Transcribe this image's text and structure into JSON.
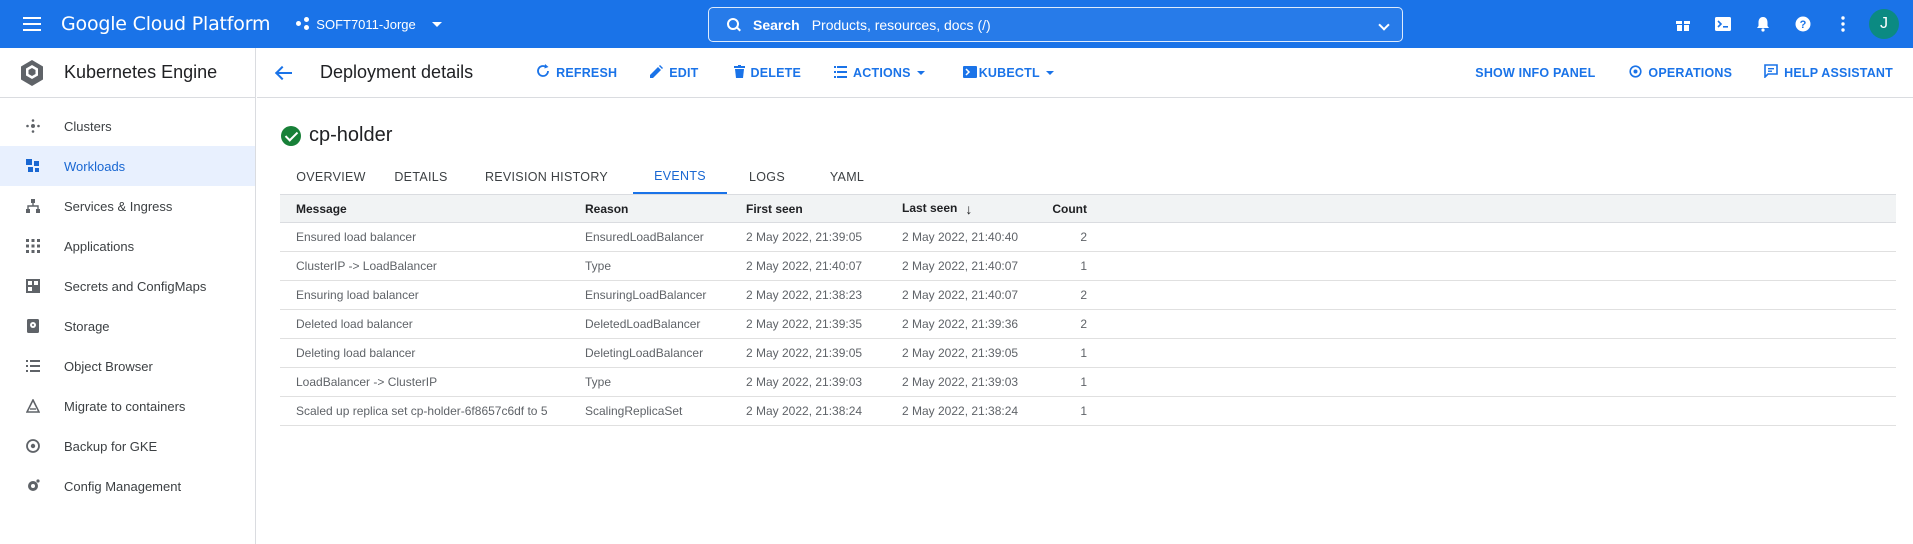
{
  "topbar": {
    "brand": "Google Cloud Platform",
    "project": "SOFT7011-Jorge",
    "search_label": "Search",
    "search_placeholder": "Products, resources, docs (/)",
    "icons": [
      "gift-icon",
      "cloud-shell-icon",
      "notifications-icon",
      "help-icon",
      "more-vert-icon"
    ],
    "avatar_initial": "J",
    "color": "#1a73e8"
  },
  "sidebar": {
    "title": "Kubernetes Engine",
    "items": [
      {
        "label": "Clusters",
        "icon": "clusters-icon"
      },
      {
        "label": "Workloads",
        "icon": "workloads-icon",
        "active": true
      },
      {
        "label": "Services & Ingress",
        "icon": "services-icon"
      },
      {
        "label": "Applications",
        "icon": "applications-icon"
      },
      {
        "label": "Secrets and ConfigMaps",
        "icon": "secrets-icon"
      },
      {
        "label": "Storage",
        "icon": "storage-icon"
      },
      {
        "label": "Object Browser",
        "icon": "object-browser-icon"
      },
      {
        "label": "Migrate to containers",
        "icon": "migrate-icon"
      },
      {
        "label": "Backup for GKE",
        "icon": "backup-icon"
      },
      {
        "label": "Config Management",
        "icon": "config-management-icon"
      }
    ]
  },
  "actionbar": {
    "title": "Deployment details",
    "refresh": "REFRESH",
    "edit": "EDIT",
    "delete": "DELETE",
    "actions": "ACTIONS",
    "kubectl": "KUBECTL",
    "show_info_panel": "SHOW INFO PANEL",
    "operations": "OPERATIONS",
    "help_assistant": "HELP ASSISTANT"
  },
  "resource": {
    "name": "cp-holder",
    "status": "ok"
  },
  "tabs": [
    {
      "label": "OVERVIEW"
    },
    {
      "label": "DETAILS"
    },
    {
      "label": "REVISION HISTORY"
    },
    {
      "label": "EVENTS",
      "active": true
    },
    {
      "label": "LOGS"
    },
    {
      "label": "YAML"
    }
  ],
  "events": {
    "headers": {
      "message": "Message",
      "reason": "Reason",
      "first_seen": "First seen",
      "last_seen": "Last seen",
      "count": "Count"
    },
    "sort_column": "last_seen",
    "rows": [
      {
        "message": "Ensured load balancer",
        "reason": "EnsuredLoadBalancer",
        "first_seen": "2 May 2022, 21:39:05",
        "last_seen": "2 May 2022, 21:40:40",
        "count": "2"
      },
      {
        "message": "ClusterIP -> LoadBalancer",
        "reason": "Type",
        "first_seen": "2 May 2022, 21:40:07",
        "last_seen": "2 May 2022, 21:40:07",
        "count": "1"
      },
      {
        "message": "Ensuring load balancer",
        "reason": "EnsuringLoadBalancer",
        "first_seen": "2 May 2022, 21:38:23",
        "last_seen": "2 May 2022, 21:40:07",
        "count": "2"
      },
      {
        "message": "Deleted load balancer",
        "reason": "DeletedLoadBalancer",
        "first_seen": "2 May 2022, 21:39:35",
        "last_seen": "2 May 2022, 21:39:36",
        "count": "2"
      },
      {
        "message": "Deleting load balancer",
        "reason": "DeletingLoadBalancer",
        "first_seen": "2 May 2022, 21:39:05",
        "last_seen": "2 May 2022, 21:39:05",
        "count": "1"
      },
      {
        "message": "LoadBalancer -> ClusterIP",
        "reason": "Type",
        "first_seen": "2 May 2022, 21:39:03",
        "last_seen": "2 May 2022, 21:39:03",
        "count": "1"
      },
      {
        "message": "Scaled up replica set cp-holder-6f8657c6df to 5",
        "reason": "ScalingReplicaSet",
        "first_seen": "2 May 2022, 21:38:24",
        "last_seen": "2 May 2022, 21:38:24",
        "count": "1"
      }
    ]
  }
}
